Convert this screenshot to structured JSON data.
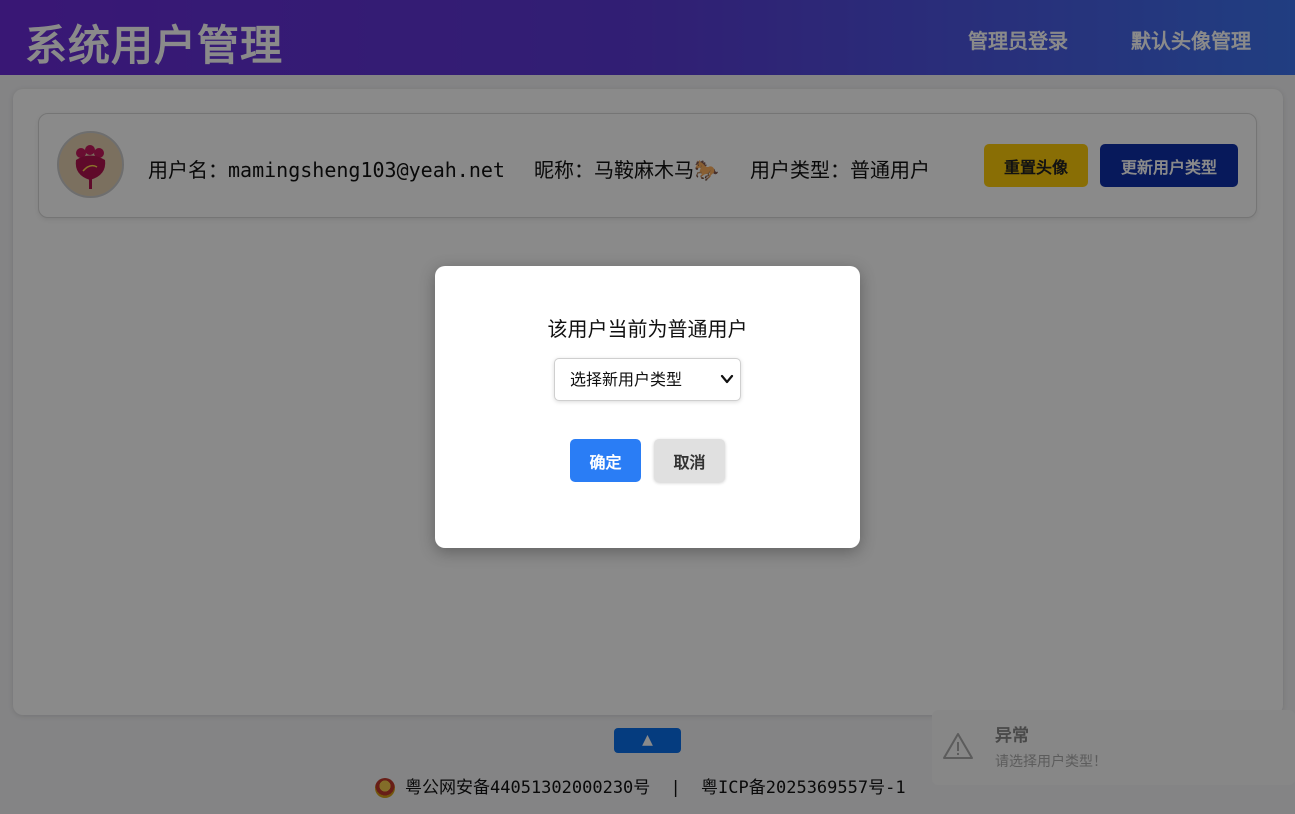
{
  "header": {
    "title": "系统用户管理",
    "nav": [
      "管理员登录",
      "默认头像管理"
    ]
  },
  "user_card": {
    "username_label": "用户名：",
    "username": "mamingsheng103@yeah.net",
    "nickname_label": "昵称：",
    "nickname": "马鞍麻木马🐎",
    "type_label": "用户类型：",
    "type": "普通用户",
    "reset_avatar_button": "重置头像",
    "update_type_button": "更新用户类型"
  },
  "modal": {
    "message": "该用户当前为普通用户",
    "select_placeholder": "选择新用户类型",
    "confirm_button": "确定",
    "cancel_button": "取消"
  },
  "scroll_top_icon": "▲",
  "footer": {
    "police_record": "粤公网安备44051302000230号",
    "separator": "|",
    "icp_record": "粤ICP备2025369557号-1"
  },
  "toast": {
    "title": "异常",
    "message": "请选择用户类型！",
    "icon": "warning-icon"
  }
}
